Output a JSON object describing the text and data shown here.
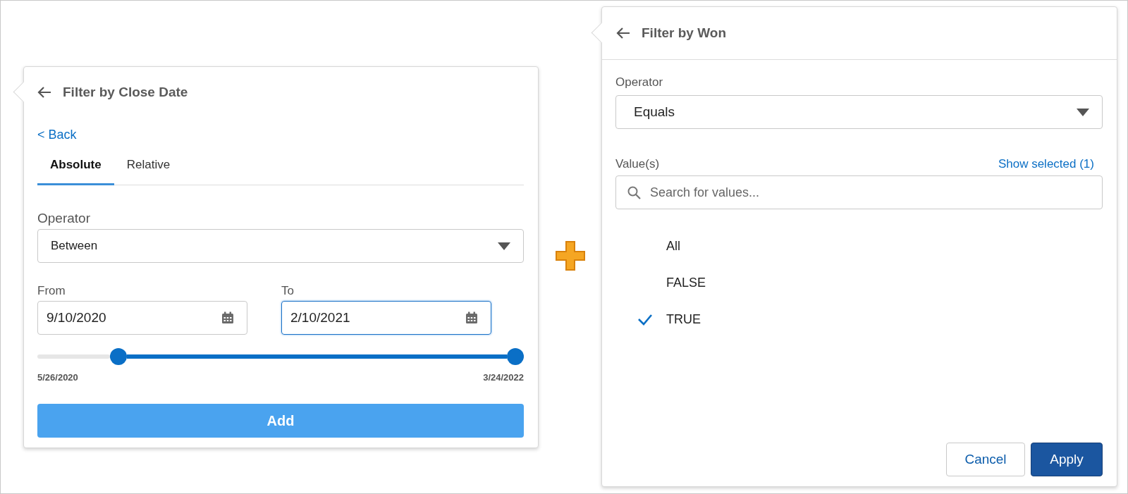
{
  "close_date_panel": {
    "title": "Filter by Close Date",
    "back_link": "< Back",
    "tabs": [
      {
        "label": "Absolute",
        "selected": true
      },
      {
        "label": "Relative",
        "selected": false
      }
    ],
    "operator": {
      "label": "Operator",
      "value": "Between"
    },
    "from": {
      "label": "From",
      "value": "9/10/2020",
      "focused": false
    },
    "to": {
      "label": "To",
      "value": "2/10/2021",
      "focused": true
    },
    "slider": {
      "thumbs": [
        {
          "level": 0.17
        },
        {
          "level": 1
        }
      ],
      "min_label": "5/26/2020",
      "max_label": "3/24/2022"
    },
    "button": "Add"
  },
  "won_panel": {
    "title": "Filter by Won",
    "operator": {
      "label": "Operator",
      "value": "Equals"
    },
    "values_label": "Value(s)",
    "show_selected_link": "Show selected (1)",
    "search": {
      "placeholder": "Search for values..."
    },
    "options": [
      {
        "label": "All",
        "selected": false
      },
      {
        "label": "FALSE",
        "selected": false
      },
      {
        "label": "TRUE",
        "selected": true
      }
    ],
    "buttons": [
      {
        "label": "Cancel",
        "kind": "secondary"
      },
      {
        "label": "Apply",
        "kind": "primary"
      }
    ]
  }
}
